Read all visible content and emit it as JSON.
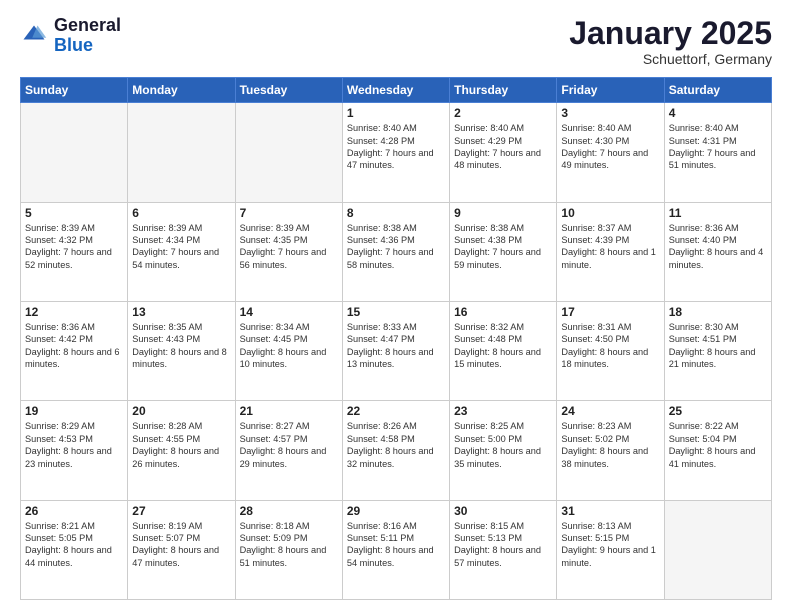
{
  "header": {
    "logo_general": "General",
    "logo_blue": "Blue",
    "month_title": "January 2025",
    "location": "Schuettorf, Germany"
  },
  "days_of_week": [
    "Sunday",
    "Monday",
    "Tuesday",
    "Wednesday",
    "Thursday",
    "Friday",
    "Saturday"
  ],
  "weeks": [
    [
      {
        "day": "",
        "empty": true
      },
      {
        "day": "",
        "empty": true
      },
      {
        "day": "",
        "empty": true
      },
      {
        "day": "1",
        "sunrise": "8:40 AM",
        "sunset": "4:28 PM",
        "daylight": "7 hours and 47 minutes."
      },
      {
        "day": "2",
        "sunrise": "8:40 AM",
        "sunset": "4:29 PM",
        "daylight": "7 hours and 48 minutes."
      },
      {
        "day": "3",
        "sunrise": "8:40 AM",
        "sunset": "4:30 PM",
        "daylight": "7 hours and 49 minutes."
      },
      {
        "day": "4",
        "sunrise": "8:40 AM",
        "sunset": "4:31 PM",
        "daylight": "7 hours and 51 minutes."
      }
    ],
    [
      {
        "day": "5",
        "sunrise": "8:39 AM",
        "sunset": "4:32 PM",
        "daylight": "7 hours and 52 minutes."
      },
      {
        "day": "6",
        "sunrise": "8:39 AM",
        "sunset": "4:34 PM",
        "daylight": "7 hours and 54 minutes."
      },
      {
        "day": "7",
        "sunrise": "8:39 AM",
        "sunset": "4:35 PM",
        "daylight": "7 hours and 56 minutes."
      },
      {
        "day": "8",
        "sunrise": "8:38 AM",
        "sunset": "4:36 PM",
        "daylight": "7 hours and 58 minutes."
      },
      {
        "day": "9",
        "sunrise": "8:38 AM",
        "sunset": "4:38 PM",
        "daylight": "7 hours and 59 minutes."
      },
      {
        "day": "10",
        "sunrise": "8:37 AM",
        "sunset": "4:39 PM",
        "daylight": "8 hours and 1 minute."
      },
      {
        "day": "11",
        "sunrise": "8:36 AM",
        "sunset": "4:40 PM",
        "daylight": "8 hours and 4 minutes."
      }
    ],
    [
      {
        "day": "12",
        "sunrise": "8:36 AM",
        "sunset": "4:42 PM",
        "daylight": "8 hours and 6 minutes."
      },
      {
        "day": "13",
        "sunrise": "8:35 AM",
        "sunset": "4:43 PM",
        "daylight": "8 hours and 8 minutes."
      },
      {
        "day": "14",
        "sunrise": "8:34 AM",
        "sunset": "4:45 PM",
        "daylight": "8 hours and 10 minutes."
      },
      {
        "day": "15",
        "sunrise": "8:33 AM",
        "sunset": "4:47 PM",
        "daylight": "8 hours and 13 minutes."
      },
      {
        "day": "16",
        "sunrise": "8:32 AM",
        "sunset": "4:48 PM",
        "daylight": "8 hours and 15 minutes."
      },
      {
        "day": "17",
        "sunrise": "8:31 AM",
        "sunset": "4:50 PM",
        "daylight": "8 hours and 18 minutes."
      },
      {
        "day": "18",
        "sunrise": "8:30 AM",
        "sunset": "4:51 PM",
        "daylight": "8 hours and 21 minutes."
      }
    ],
    [
      {
        "day": "19",
        "sunrise": "8:29 AM",
        "sunset": "4:53 PM",
        "daylight": "8 hours and 23 minutes."
      },
      {
        "day": "20",
        "sunrise": "8:28 AM",
        "sunset": "4:55 PM",
        "daylight": "8 hours and 26 minutes."
      },
      {
        "day": "21",
        "sunrise": "8:27 AM",
        "sunset": "4:57 PM",
        "daylight": "8 hours and 29 minutes."
      },
      {
        "day": "22",
        "sunrise": "8:26 AM",
        "sunset": "4:58 PM",
        "daylight": "8 hours and 32 minutes."
      },
      {
        "day": "23",
        "sunrise": "8:25 AM",
        "sunset": "5:00 PM",
        "daylight": "8 hours and 35 minutes."
      },
      {
        "day": "24",
        "sunrise": "8:23 AM",
        "sunset": "5:02 PM",
        "daylight": "8 hours and 38 minutes."
      },
      {
        "day": "25",
        "sunrise": "8:22 AM",
        "sunset": "5:04 PM",
        "daylight": "8 hours and 41 minutes."
      }
    ],
    [
      {
        "day": "26",
        "sunrise": "8:21 AM",
        "sunset": "5:05 PM",
        "daylight": "8 hours and 44 minutes."
      },
      {
        "day": "27",
        "sunrise": "8:19 AM",
        "sunset": "5:07 PM",
        "daylight": "8 hours and 47 minutes."
      },
      {
        "day": "28",
        "sunrise": "8:18 AM",
        "sunset": "5:09 PM",
        "daylight": "8 hours and 51 minutes."
      },
      {
        "day": "29",
        "sunrise": "8:16 AM",
        "sunset": "5:11 PM",
        "daylight": "8 hours and 54 minutes."
      },
      {
        "day": "30",
        "sunrise": "8:15 AM",
        "sunset": "5:13 PM",
        "daylight": "8 hours and 57 minutes."
      },
      {
        "day": "31",
        "sunrise": "8:13 AM",
        "sunset": "5:15 PM",
        "daylight": "9 hours and 1 minute."
      },
      {
        "day": "",
        "empty": true
      }
    ]
  ]
}
